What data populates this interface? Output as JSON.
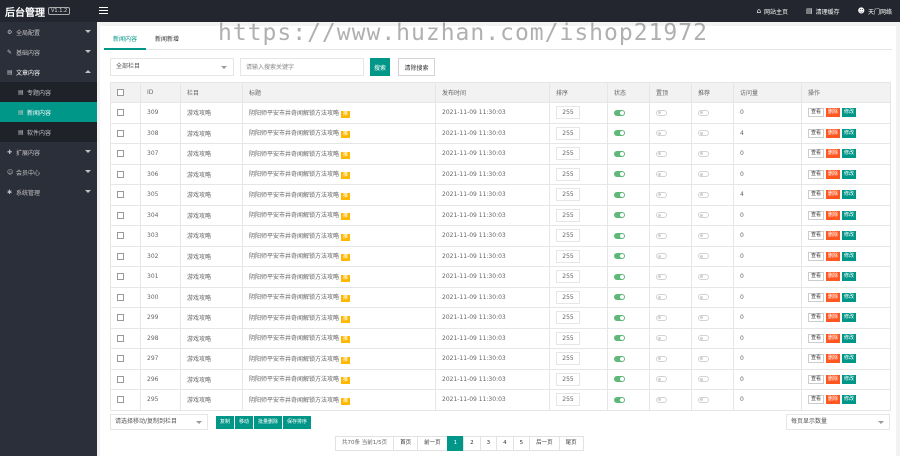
{
  "app": {
    "title": "后台管理",
    "version": "V1.1.2"
  },
  "topbar": {
    "links": [
      {
        "icon": "home-icon",
        "label": "网站主页"
      },
      {
        "icon": "trash-icon",
        "label": "清理缓存"
      },
      {
        "icon": "user-icon",
        "label": "天门网络"
      }
    ]
  },
  "sidebar": {
    "items": [
      {
        "label": "全局配置",
        "icon": "gear-icon",
        "expandable": true
      },
      {
        "label": "基础内容",
        "icon": "edit-icon",
        "expandable": true
      },
      {
        "label": "文章内容",
        "icon": "document-icon",
        "expandable": true,
        "open": true,
        "children": [
          {
            "label": "专题内容",
            "active": false
          },
          {
            "label": "新闻内容",
            "active": true
          },
          {
            "label": "软件内容",
            "active": false
          }
        ]
      },
      {
        "label": "扩展内容",
        "icon": "puzzle-icon",
        "expandable": true
      },
      {
        "label": "会员中心",
        "icon": "user-icon",
        "expandable": true
      },
      {
        "label": "系统管理",
        "icon": "settings-icon",
        "expandable": true
      }
    ]
  },
  "tabs": [
    {
      "label": "新闻内容",
      "active": true
    },
    {
      "label": "新闻新增",
      "active": false
    }
  ],
  "filters": {
    "category_select": "全部栏目",
    "search_placeholder": "请输入搜索关键字",
    "search_button": "搜索",
    "clear_button": "清除搜索"
  },
  "table": {
    "headers": [
      "",
      "ID",
      "栏目",
      "标题",
      "发布时间",
      "排序",
      "状态",
      "置顶",
      "推荐",
      "访问量",
      "操作"
    ],
    "rows": [
      {
        "id": "309",
        "category": "游戏攻略",
        "title": "阴阳师平安市井奇闻解锁方法攻略",
        "badge": "推",
        "time": "2021-11-09 11:30:03",
        "sort": "255",
        "status": true,
        "top": false,
        "rec": false,
        "views": "0"
      },
      {
        "id": "308",
        "category": "游戏攻略",
        "title": "阴阳师平安市井奇闻解锁方法攻略",
        "badge": "推",
        "time": "2021-11-09 11:30:03",
        "sort": "255",
        "status": true,
        "top": false,
        "rec": false,
        "views": "4"
      },
      {
        "id": "307",
        "category": "游戏攻略",
        "title": "阴阳师平安市井奇闻解锁方法攻略",
        "badge": "推",
        "time": "2021-11-09 11:30:03",
        "sort": "255",
        "status": true,
        "top": false,
        "rec": false,
        "views": "0"
      },
      {
        "id": "306",
        "category": "游戏攻略",
        "title": "阴阳师平安市井奇闻解锁方法攻略",
        "badge": "推",
        "time": "2021-11-09 11:30:03",
        "sort": "255",
        "status": true,
        "top": false,
        "rec": false,
        "views": "0"
      },
      {
        "id": "305",
        "category": "游戏攻略",
        "title": "阴阳师平安市井奇闻解锁方法攻略",
        "badge": "推",
        "time": "2021-11-09 11:30:03",
        "sort": "255",
        "status": true,
        "top": false,
        "rec": false,
        "views": "4"
      },
      {
        "id": "304",
        "category": "游戏攻略",
        "title": "阴阳师平安市井奇闻解锁方法攻略",
        "badge": "推",
        "time": "2021-11-09 11:30:03",
        "sort": "255",
        "status": true,
        "top": false,
        "rec": false,
        "views": "0"
      },
      {
        "id": "303",
        "category": "游戏攻略",
        "title": "阴阳师平安市井奇闻解锁方法攻略",
        "badge": "推",
        "time": "2021-11-09 11:30:03",
        "sort": "255",
        "status": true,
        "top": false,
        "rec": false,
        "views": "0"
      },
      {
        "id": "302",
        "category": "游戏攻略",
        "title": "阴阳师平安市井奇闻解锁方法攻略",
        "badge": "推",
        "time": "2021-11-09 11:30:03",
        "sort": "255",
        "status": true,
        "top": false,
        "rec": false,
        "views": "0"
      },
      {
        "id": "301",
        "category": "游戏攻略",
        "title": "阴阳师平安市井奇闻解锁方法攻略",
        "badge": "推",
        "time": "2021-11-09 11:30:03",
        "sort": "255",
        "status": true,
        "top": false,
        "rec": false,
        "views": "0"
      },
      {
        "id": "300",
        "category": "游戏攻略",
        "title": "阴阳师平安市井奇闻解锁方法攻略",
        "badge": "推",
        "time": "2021-11-09 11:30:03",
        "sort": "255",
        "status": true,
        "top": false,
        "rec": false,
        "views": "0"
      },
      {
        "id": "299",
        "category": "游戏攻略",
        "title": "阴阳师平安市井奇闻解锁方法攻略",
        "badge": "推",
        "time": "2021-11-09 11:30:03",
        "sort": "255",
        "status": true,
        "top": false,
        "rec": false,
        "views": "0"
      },
      {
        "id": "298",
        "category": "游戏攻略",
        "title": "阴阳师平安市井奇闻解锁方法攻略",
        "badge": "推",
        "time": "2021-11-09 11:30:03",
        "sort": "255",
        "status": true,
        "top": false,
        "rec": false,
        "views": "0"
      },
      {
        "id": "297",
        "category": "游戏攻略",
        "title": "阴阳师平安市井奇闻解锁方法攻略",
        "badge": "推",
        "time": "2021-11-09 11:30:03",
        "sort": "255",
        "status": true,
        "top": false,
        "rec": false,
        "views": "0"
      },
      {
        "id": "296",
        "category": "游戏攻略",
        "title": "阴阳师平安市井奇闻解锁方法攻略",
        "badge": "推",
        "time": "2021-11-09 11:30:03",
        "sort": "255",
        "status": true,
        "top": false,
        "rec": false,
        "views": "0"
      },
      {
        "id": "295",
        "category": "游戏攻略",
        "title": "阴阳师平安市井奇闻解锁方法攻略",
        "badge": "推",
        "time": "2021-11-09 11:30:03",
        "sort": "255",
        "status": true,
        "top": false,
        "rec": false,
        "views": "0"
      }
    ],
    "actions": {
      "view": "查看",
      "delete": "删除",
      "edit": "修改"
    }
  },
  "bulk": {
    "move_select": "请选择移动/复制到栏目",
    "buttons": [
      "复制",
      "移动",
      "批量删除",
      "保存排序"
    ],
    "per_page": "每页显示数量"
  },
  "pagination": {
    "info": "共70条 当前1/5页",
    "first": "首页",
    "prev": "前一页",
    "pages": [
      "1",
      "2",
      "3",
      "4",
      "5"
    ],
    "current": "1",
    "next": "后一页",
    "last": "尾页"
  },
  "watermark": "https://www.huzhan.com/ishop21972",
  "colors": {
    "accent": "#009688",
    "danger": "#ff5722",
    "badge": "#ffb800",
    "switch_on": "#5fb878",
    "sidebar": "#2b2f3a",
    "topbar": "#23262e"
  }
}
